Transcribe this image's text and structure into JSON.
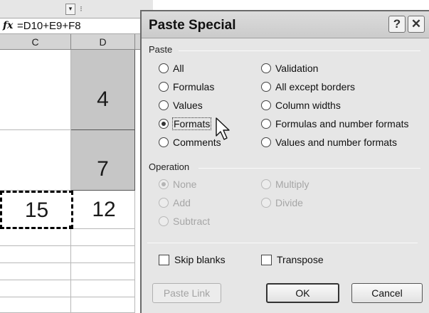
{
  "spreadsheet": {
    "namebox_dropdown": "▾",
    "toolbar_grip": "⁝",
    "fx_label": "fx",
    "formula": "=D10+E9+F8",
    "columns": [
      "C",
      "D"
    ],
    "cells": {
      "d_upper": "4",
      "d_lower": "7",
      "c_selected": "15",
      "d_bottom": "12"
    }
  },
  "dialog": {
    "title": "Paste Special",
    "help_label": "?",
    "close_label": "✕",
    "paste_group": {
      "label": "Paste",
      "left_options": [
        {
          "label": "All",
          "checked": false
        },
        {
          "label": "Formulas",
          "checked": false
        },
        {
          "label": "Values",
          "checked": false
        },
        {
          "label": "Formats",
          "checked": true
        },
        {
          "label": "Comments",
          "checked": false
        }
      ],
      "right_options": [
        {
          "label": "Validation",
          "checked": false
        },
        {
          "label": "All except borders",
          "checked": false
        },
        {
          "label": "Column widths",
          "checked": false
        },
        {
          "label": "Formulas and number formats",
          "checked": false
        },
        {
          "label": "Values and number formats",
          "checked": false
        }
      ]
    },
    "operation_group": {
      "label": "Operation",
      "left_options": [
        {
          "label": "None",
          "checked": true
        },
        {
          "label": "Add",
          "checked": false
        },
        {
          "label": "Subtract",
          "checked": false
        }
      ],
      "right_options": [
        {
          "label": "Multiply",
          "checked": false
        },
        {
          "label": "Divide",
          "checked": false
        }
      ]
    },
    "skip_blanks_label": "Skip blanks",
    "transpose_label": "Transpose",
    "paste_link_label": "Paste Link",
    "ok_label": "OK",
    "cancel_label": "Cancel"
  },
  "colors": {
    "dialog_bg": "#e6e6e6",
    "cell_shade": "#c6c6c6",
    "disabled_text": "#a6a6a6"
  }
}
